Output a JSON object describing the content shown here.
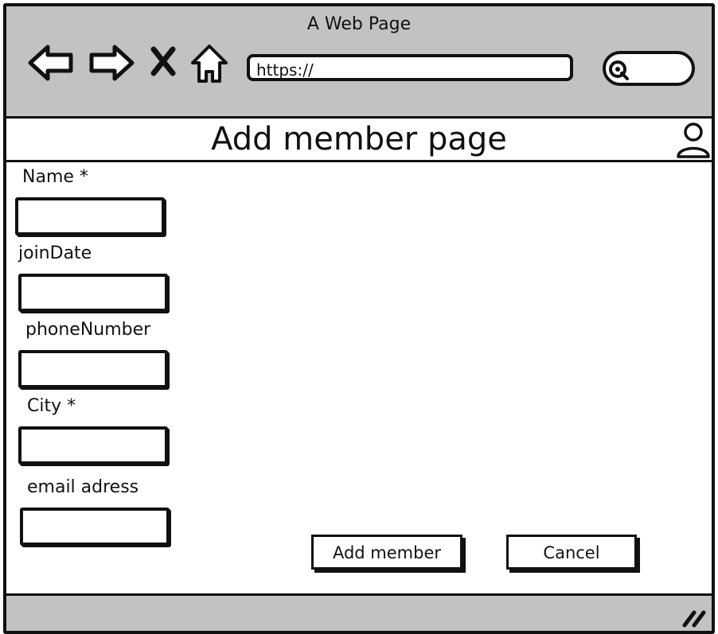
{
  "window": {
    "title": "A Web Page"
  },
  "browser": {
    "url": "https://",
    "icons": [
      "back-arrow-icon",
      "forward-arrow-icon",
      "close-x-icon",
      "home-icon",
      "search-icon",
      "user-icon",
      "resize-grip-icon"
    ]
  },
  "page": {
    "title": "Add member page"
  },
  "form": {
    "name_label": "Name  *",
    "joindate_label": "joinDate",
    "phone_label": "phoneNumber",
    "city_label": "City *",
    "email_label": "email adress"
  },
  "actions": {
    "add_label": "Add member",
    "cancel_label": "Cancel"
  }
}
